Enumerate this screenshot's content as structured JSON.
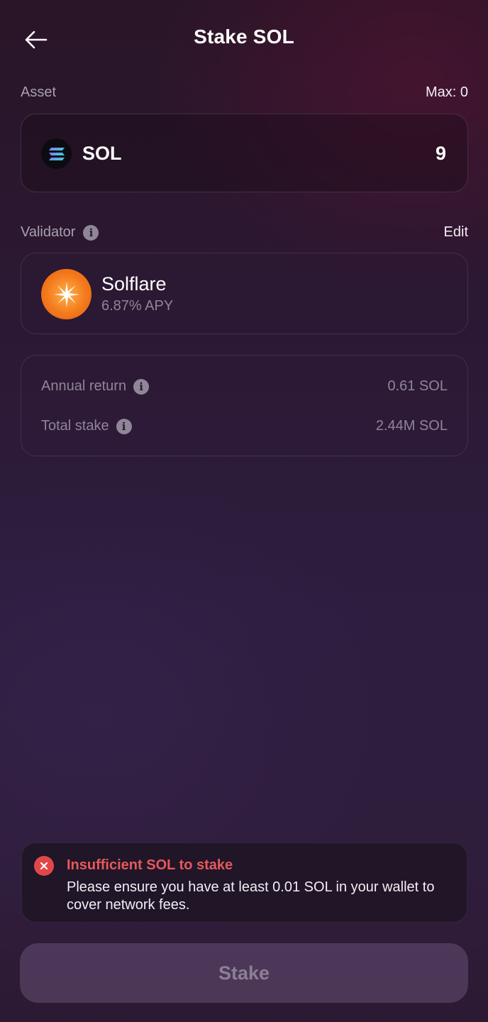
{
  "header": {
    "title": "Stake SOL",
    "back_icon": "arrow-left-icon"
  },
  "asset": {
    "label": "Asset",
    "max_label": "Max: 0",
    "token_icon": "solana-logo-icon",
    "token_name": "SOL",
    "amount": "9"
  },
  "validator": {
    "label": "Validator",
    "edit_label": "Edit",
    "name": "Solflare",
    "apy": "6.87% APY",
    "avatar_icon": "solflare-logo-icon"
  },
  "stats": {
    "annual_return_label": "Annual return",
    "annual_return_value": "0.61 SOL",
    "total_stake_label": "Total stake",
    "total_stake_value": "2.44M SOL"
  },
  "error": {
    "icon": "error-x-icon",
    "title": "Insufficient SOL to stake",
    "message": "Please ensure you have at least 0.01 SOL in your wallet to cover network fees."
  },
  "footer": {
    "stake_label": "Stake"
  },
  "colors": {
    "error_red": "#e04848",
    "muted_text": "#8f8697",
    "accent_orange": "#f47a1c"
  }
}
